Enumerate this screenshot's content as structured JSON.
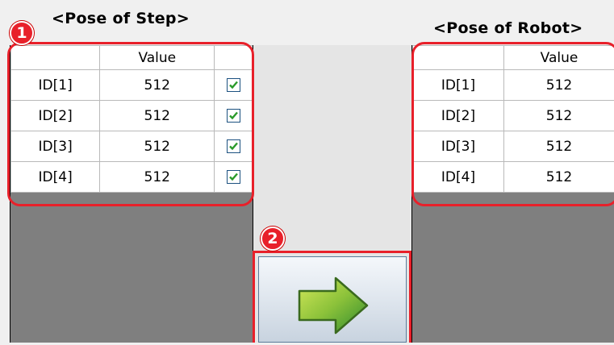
{
  "step_panel": {
    "title": "<Pose of Step>",
    "header": [
      "",
      "Value",
      ""
    ],
    "rows": [
      {
        "id": "ID[1]",
        "value": "512",
        "checked": true
      },
      {
        "id": "ID[2]",
        "value": "512",
        "checked": true
      },
      {
        "id": "ID[3]",
        "value": "512",
        "checked": true
      },
      {
        "id": "ID[4]",
        "value": "512",
        "checked": true
      }
    ]
  },
  "robot_panel": {
    "title": "<Pose of Robot>",
    "header": [
      "",
      "Value"
    ],
    "rows": [
      {
        "id": "ID[1]",
        "value": "512"
      },
      {
        "id": "ID[2]",
        "value": "512"
      },
      {
        "id": "ID[3]",
        "value": "512"
      },
      {
        "id": "ID[4]",
        "value": "512"
      }
    ]
  },
  "callouts": {
    "one": "1",
    "two": "2"
  },
  "transfer_button": {
    "icon": "right-arrow-icon"
  },
  "colors": {
    "callout_red": "#e8202a",
    "grid_bg_gray": "#7f7f7f",
    "arrow_green_light": "#b6d93c",
    "arrow_green_dark": "#2e8a2e",
    "check_green": "#2a9a2a"
  }
}
